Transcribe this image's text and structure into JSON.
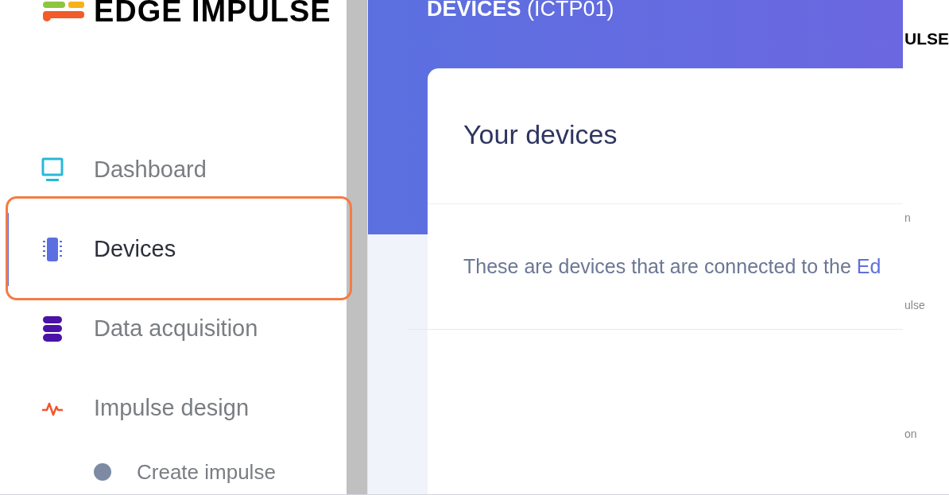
{
  "logo": {
    "text": "EDGE IMPULSE"
  },
  "sidebar": {
    "items": [
      {
        "label": "Dashboard",
        "kind": "monitor",
        "selected": false
      },
      {
        "label": "Devices",
        "kind": "chip",
        "selected": true
      },
      {
        "label": "Data acquisition",
        "kind": "database",
        "selected": false
      },
      {
        "label": "Impulse design",
        "kind": "pulse",
        "selected": false
      },
      {
        "label": "Create impulse",
        "kind": "subitem",
        "selected": false
      }
    ]
  },
  "header": {
    "title": "**DEVICES** (ICTP01)"
  },
  "card": {
    "title": "Your devices",
    "intro": {
      "text": "These are devices that are connected to the ",
      "link": "Ed"
    }
  },
  "right_strip": [
    "ULSE",
    "n",
    "ulse",
    "on"
  ]
}
